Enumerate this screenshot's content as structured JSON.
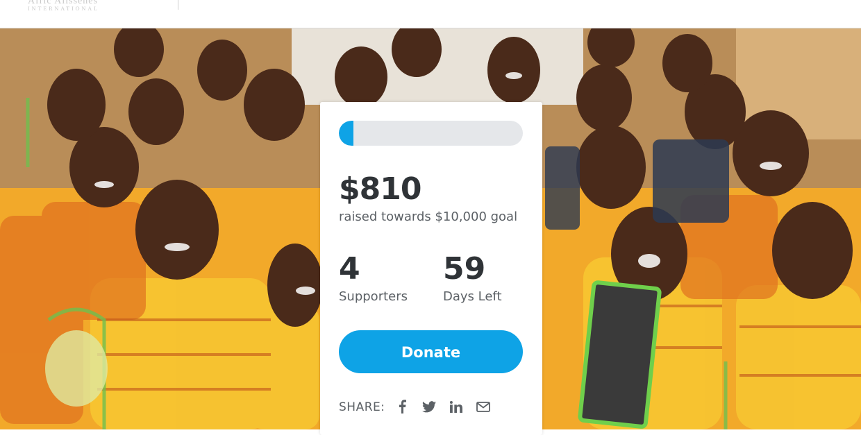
{
  "header": {
    "logo_text": "Afric Alissenes",
    "logo_sub": "INTERNATIONAL"
  },
  "hero": {
    "image_icon": "children-classroom-photo"
  },
  "campaign": {
    "raised": "$810",
    "goal_text": "raised towards $10,000 goal",
    "progress_fraction": 0.081,
    "supporters_count": "4",
    "supporters_label": "Supporters",
    "days_count": "59",
    "days_label": "Days Left",
    "donate_label": "Donate",
    "share_label": "SHARE:",
    "share_icons": [
      "facebook-icon",
      "twitter-icon",
      "linkedin-icon",
      "email-icon"
    ],
    "accent_color": "#0ea3e6"
  }
}
